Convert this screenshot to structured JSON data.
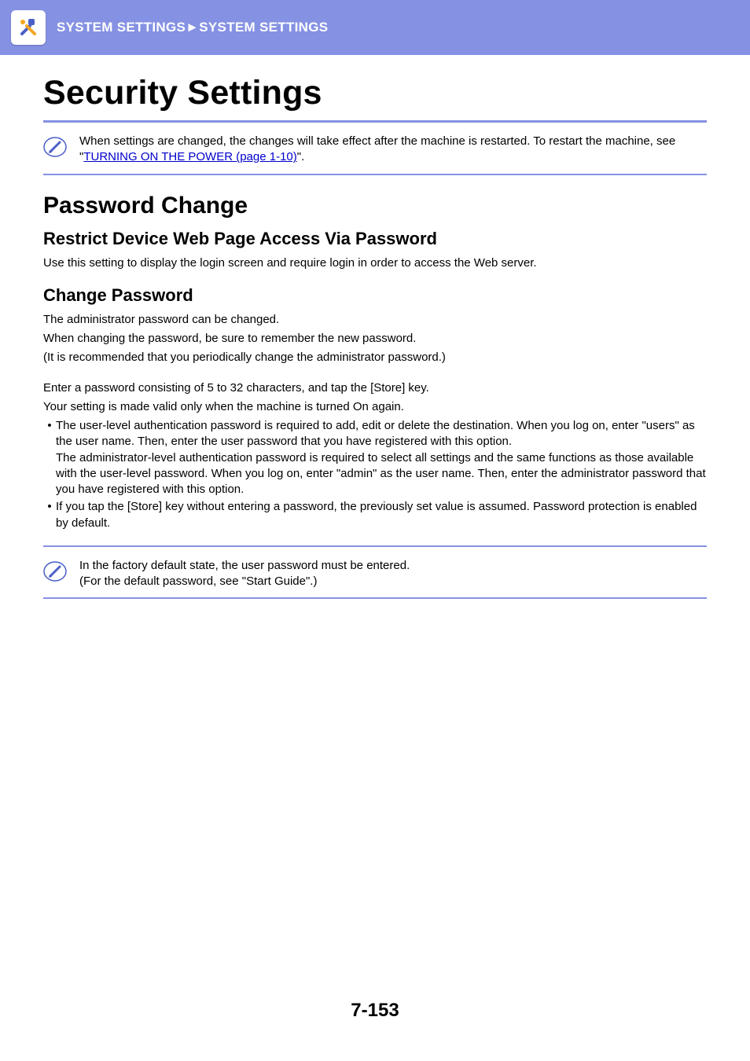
{
  "header": {
    "breadcrumb_left": "SYSTEM SETTINGS",
    "breadcrumb_sep": "►",
    "breadcrumb_right": "SYSTEM SETTINGS"
  },
  "page_title": "Security Settings",
  "info1": {
    "prefix": "When settings are changed, the changes will take effect after the machine is restarted. To restart the machine, see \"",
    "link": "TURNING ON THE POWER (page 1-10)",
    "suffix": "\"."
  },
  "section1": {
    "title": "Password Change",
    "sub1": {
      "title": "Restrict Device Web Page Access Via Password",
      "p1": "Use this setting to display the login screen and require login in order to access the Web server."
    },
    "sub2": {
      "title": "Change Password",
      "p1": "The administrator password can be changed.",
      "p2": "When changing the password, be sure to remember the new password.",
      "p3": "(It is recommended that you periodically change the administrator password.)",
      "p4": "Enter a password consisting of 5 to 32 characters, and tap the [Store] key.",
      "p5": "Your setting is made valid only when the machine is turned On again.",
      "b1a": "The user-level authentication password is required to add, edit or delete the destination. When you log on, enter \"users\" as the user name. Then, enter the user password that you have registered with this option.",
      "b1b": "The administrator-level authentication password is required to select all settings and the same functions as those available with the user-level password. When you log on, enter \"admin\" as the user name. Then, enter the administrator password that you have registered with this option.",
      "b2": "If you tap the [Store] key without entering a password, the previously set value is assumed. Password protection is enabled by default."
    }
  },
  "info2": {
    "line1": "In the factory default state, the user password must be entered.",
    "line2": "(For the default password, see \"Start Guide\".)"
  },
  "page_number": "7-153"
}
